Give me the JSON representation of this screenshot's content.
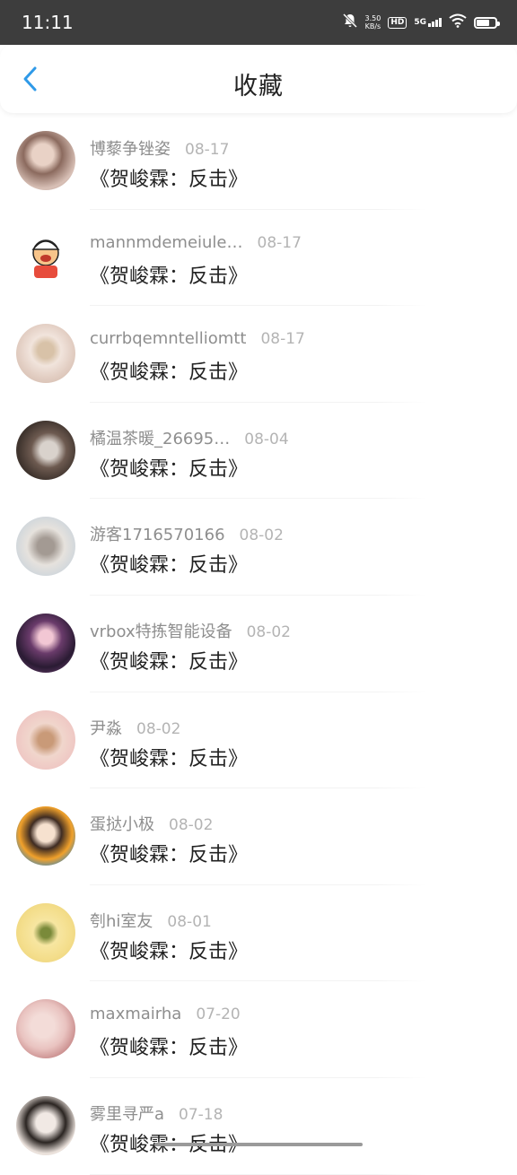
{
  "status_bar": {
    "time": "11:11",
    "net_speed_value": "3.50",
    "net_speed_unit": "KB/s",
    "hd_label": "HD",
    "network_label": "5G",
    "battery_level": 0.8,
    "icons": [
      "mute-bell-icon",
      "hd-icon",
      "signal-5g-icon",
      "wifi-icon",
      "battery-icon"
    ]
  },
  "header": {
    "title": "收藏",
    "back_icon": "chevron-left-icon",
    "accent_color": "#2f9ae8"
  },
  "favorites": [
    {
      "username": "博藜争锉姿",
      "date": "08-17",
      "title": "《贺峻霖：反击》"
    },
    {
      "username": "mannmdemeiule…",
      "date": "08-17",
      "title": "《贺峻霖：反击》"
    },
    {
      "username": "currbqemntelliomtt",
      "date": "08-17",
      "title": "《贺峻霖：反击》"
    },
    {
      "username": "橘温茶暖_26695…",
      "date": "08-04",
      "title": "《贺峻霖：反击》"
    },
    {
      "username": "游客1716570166",
      "date": "08-02",
      "title": "《贺峻霖：反击》"
    },
    {
      "username": "vrbox特拣智能设备",
      "date": "08-02",
      "title": "《贺峻霖：反击》"
    },
    {
      "username": "尹淼",
      "date": "08-02",
      "title": "《贺峻霖：反击》"
    },
    {
      "username": "蛋挞小极",
      "date": "08-02",
      "title": "《贺峻霖：反击》"
    },
    {
      "username": "刳hi室友",
      "date": "08-01",
      "title": "《贺峻霖：反击》"
    },
    {
      "username": "maxmairha",
      "date": "07-20",
      "title": "《贺峻霖：反击》"
    },
    {
      "username": "雾里寻严a",
      "date": "07-18",
      "title": "《贺峻霖：反击》"
    }
  ]
}
